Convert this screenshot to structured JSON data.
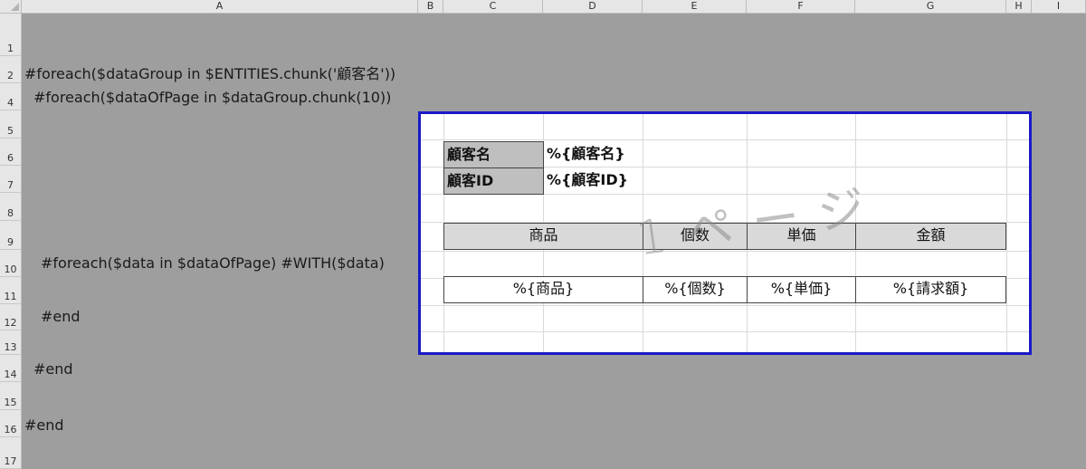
{
  "columns": [
    "A",
    "B",
    "C",
    "D",
    "E",
    "F",
    "G",
    "H",
    "I"
  ],
  "rows": [
    "1",
    "2",
    "4",
    "5",
    "6",
    "7",
    "8",
    "9",
    "10",
    "11",
    "12",
    "13",
    "14",
    "15",
    "16",
    "17"
  ],
  "cells": {
    "a2": "#foreach($dataGroup in $ENTITIES.chunk('顧客名'))",
    "a4": " #foreach($dataOfPage in $dataGroup.chunk(10))",
    "a10": "#foreach($data in $dataOfPage) #WITH($data)",
    "a12": "#end",
    "a14": "#end",
    "a16": "#end"
  },
  "page": {
    "watermark": "1ページ",
    "customer_name_label": "顧客名",
    "customer_name_value": "%{顧客名}",
    "customer_id_label": "顧客ID",
    "customer_id_value": "%{顧客ID}",
    "headers": [
      "商品",
      "個数",
      "単価",
      "金額"
    ],
    "row": [
      "%{商品}",
      "%{個数}",
      "%{単価}",
      "%{請求額}"
    ]
  },
  "colors": {
    "page_border": "#1a1ac8",
    "background": "#9e9e9e"
  }
}
